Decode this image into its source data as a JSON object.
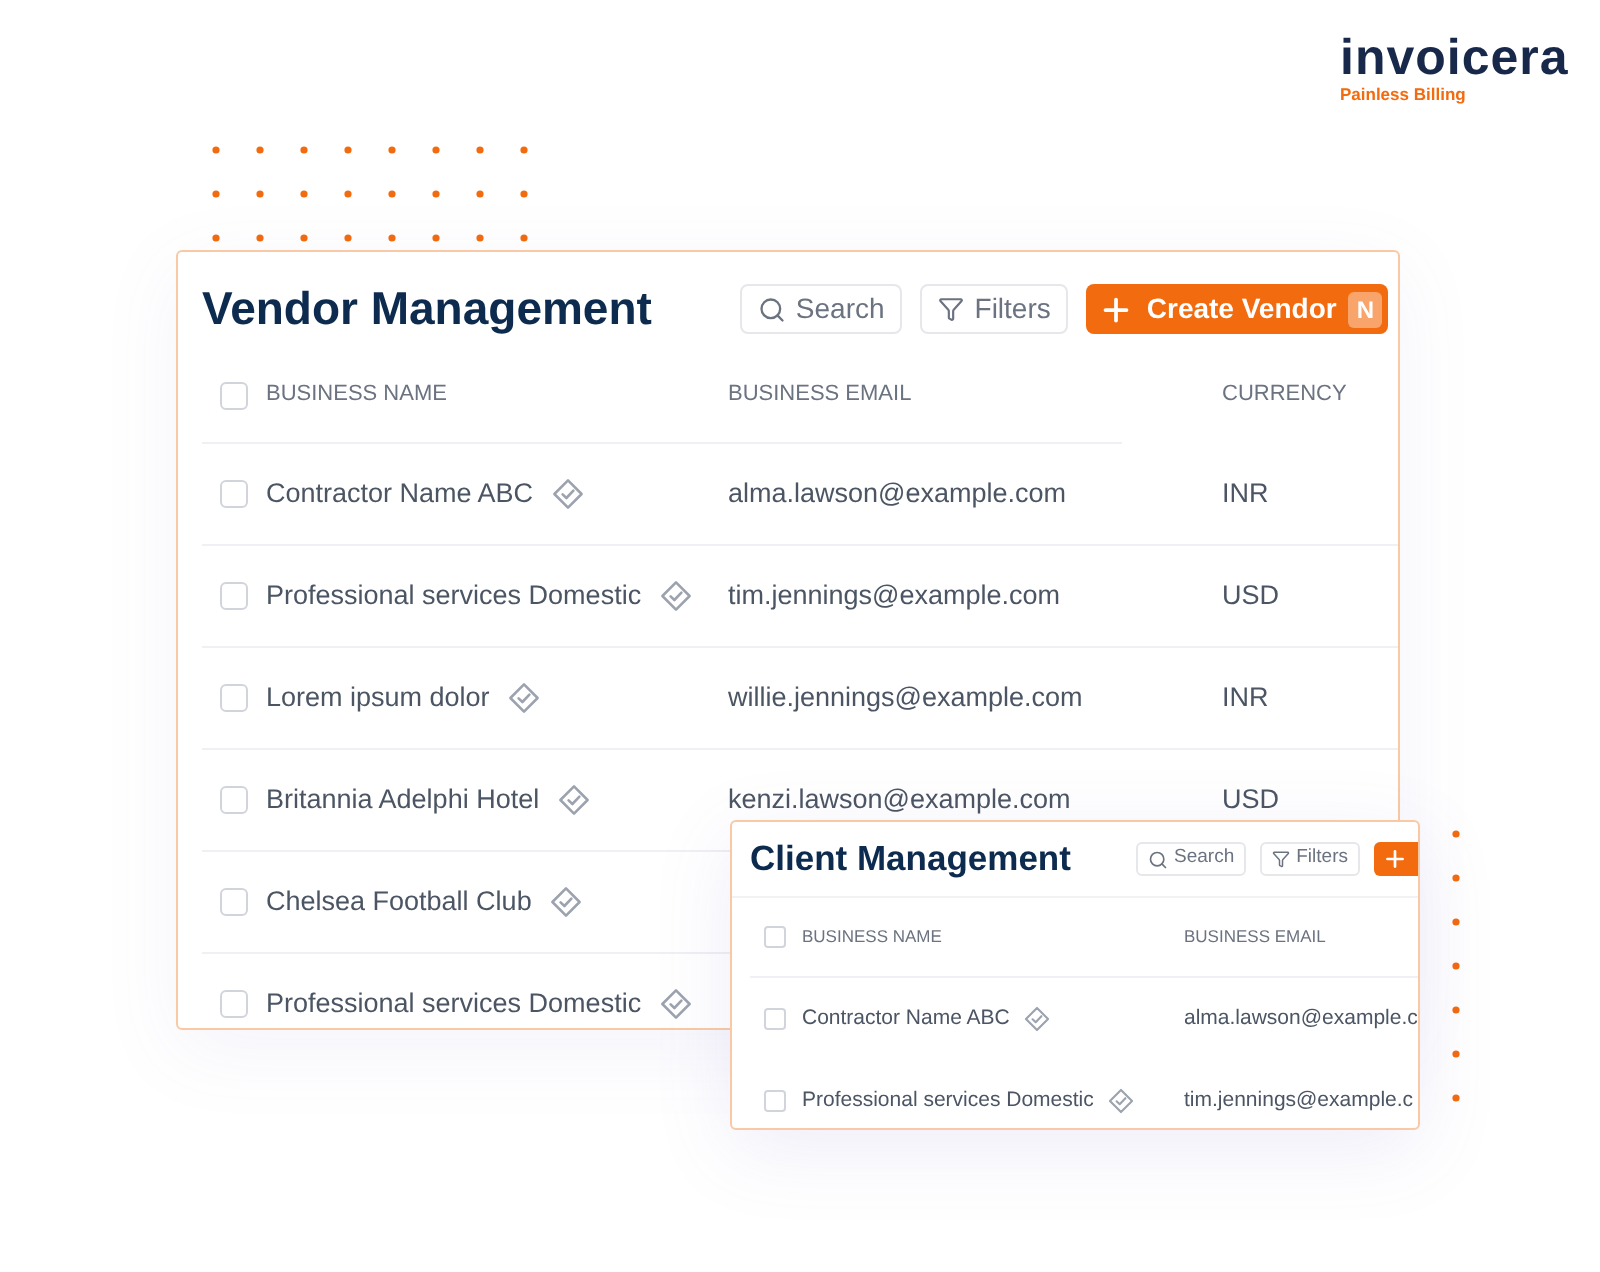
{
  "logo": {
    "name": "invoicera",
    "tagline": "Painless Billing"
  },
  "vendor_management": {
    "title": "Vendor Management",
    "search_button": "Search",
    "filters_button": "Filters",
    "create_button": {
      "label": "Create Vendor",
      "shortcut": "N"
    },
    "select_all_checked": false,
    "columns": [
      "BUSINESS NAME",
      "BUSINESS EMAIL",
      "CURRENCY"
    ],
    "rows": [
      {
        "checked": false,
        "business_name": "Contractor Name ABC",
        "verified": true,
        "business_email": "alma.lawson@example.com",
        "currency": "INR"
      },
      {
        "checked": false,
        "business_name": "Professional services Domestic",
        "verified": true,
        "business_email": "tim.jennings@example.com",
        "currency": "USD"
      },
      {
        "checked": false,
        "business_name": "Lorem ipsum dolor",
        "verified": true,
        "business_email": "willie.jennings@example.com",
        "currency": "INR"
      },
      {
        "checked": false,
        "business_name": "Britannia Adelphi Hotel",
        "verified": true,
        "business_email": "kenzi.lawson@example.com",
        "currency": "USD"
      },
      {
        "checked": false,
        "business_name": "Chelsea Football Club",
        "verified": true
      },
      {
        "checked": false,
        "business_name": "Professional services Domestic",
        "verified": true
      }
    ]
  },
  "client_management": {
    "title": "Client Management",
    "search_button": "Search",
    "filters_button": "Filters",
    "select_all_checked": false,
    "columns": [
      "BUSINESS NAME",
      "BUSINESS EMAIL"
    ],
    "rows": [
      {
        "checked": false,
        "business_name": "Contractor Name ABC",
        "verified": true,
        "business_email": "alma.lawson@example.c"
      },
      {
        "checked": false,
        "business_name": "Professional services Domestic",
        "verified": true,
        "business_email": "tim.jennings@example.c"
      }
    ]
  }
}
